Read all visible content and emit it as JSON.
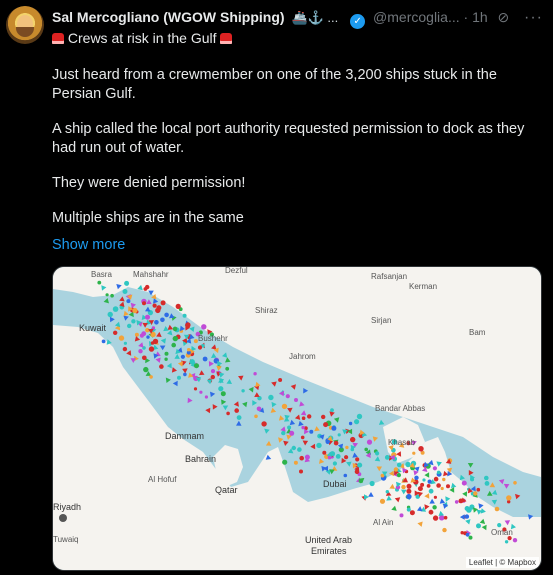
{
  "post": {
    "author": "Sal Mercogliano (WGOW Shipping)",
    "author_emojis": "🚢⚓ ...",
    "handle": "@mercoglia...",
    "separator": "·",
    "time": "1h",
    "headline": "Crews at risk in the Gulf",
    "paragraphs": [
      "Just heard from a crewmember on one of the 3,200 ships stuck in the Persian Gulf.",
      "A ship called the local port authority requested permission to dock as they had run out of water.",
      "They were denied permission!",
      "Multiple ships are in the same"
    ],
    "show_more": "Show more"
  },
  "map": {
    "labels": {
      "basra": "Basra",
      "mahshahr": "Mahshahr",
      "kuwait": "Kuwait",
      "bushehr": "Bushehr",
      "shiraz": "Shiraz",
      "jahrom": "Jahrom",
      "kerman": "Kerman",
      "rafsanjan": "Rafsanjan",
      "sirjan": "Sirjan",
      "bam": "Bam",
      "bandar_abbas": "Bandar Abbas",
      "khasab": "Khasab",
      "dammam": "Dammam",
      "bahrain": "Bahrain",
      "qatar": "Qatar",
      "al_hofuf": "Al Hofuf",
      "dubai": "Dubai",
      "al_ain": "Al Ain",
      "uae": "United Arab\nEmirates",
      "riyadh": "Riyadh",
      "oman": "Oman",
      "tuwaiq": "Tuwaiq",
      "top_label": "Dezful"
    },
    "attribution": "Leaflet | © Mapbox",
    "colors": {
      "sea": "#aad3df",
      "land": "#f5f3ef",
      "ship_cargo": "#d62b2b",
      "ship_tanker": "#2fc7c2",
      "ship_passenger": "#2e6be6",
      "ship_other": "#c14bd6",
      "ship_fishing": "#f2a33a",
      "ship_green": "#2db34a"
    }
  }
}
